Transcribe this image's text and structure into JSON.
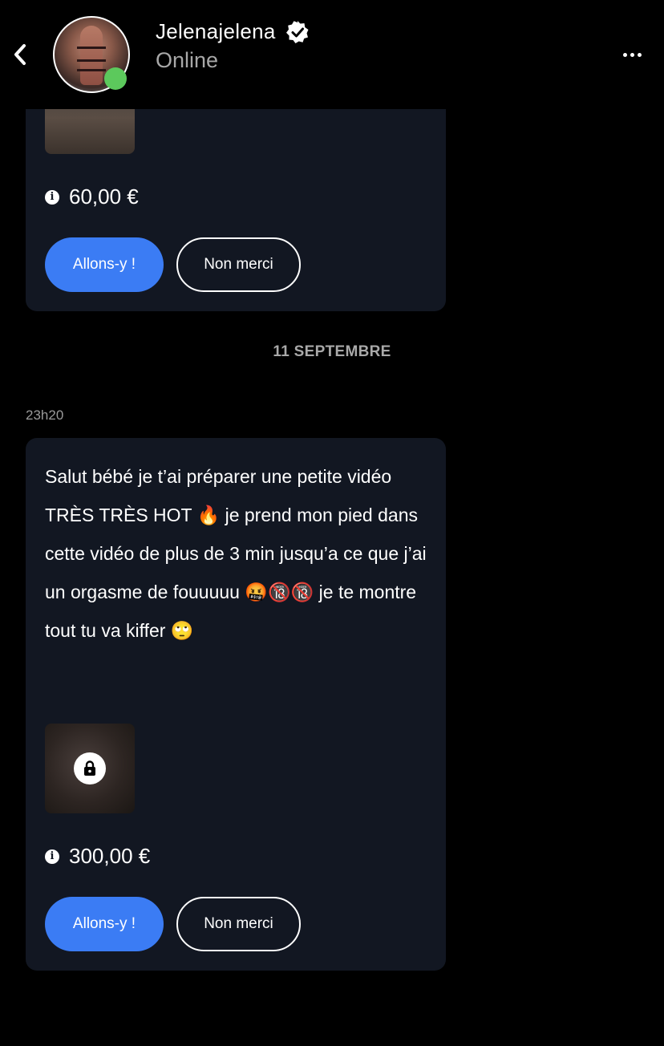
{
  "header": {
    "contact_name": "Jelenajelena",
    "status": "Online",
    "icons": {
      "back": "chevron-left-icon",
      "verified": "verified-badge-icon",
      "more": "more-horizontal-icon"
    }
  },
  "messages": [
    {
      "price": "60,00 €",
      "accept_label": "Allons-y !",
      "decline_label": "Non merci"
    },
    {
      "time": "23h20",
      "text": "Salut bébé je t’ai préparer une petite vidéo TRÈS TRÈS HOT 🔥 je prend mon pied dans cette vidéo de plus de 3 min jusqu’a ce que j’ai un orgasme de fouuuuu 🤬🔞🔞 je te montre tout tu va kiffer 🙄",
      "price": "300,00 €",
      "accept_label": "Allons-y !",
      "decline_label": "Non merci"
    }
  ],
  "date_separator": "11 SEPTEMBRE",
  "colors": {
    "background": "#000000",
    "bubble": "#121722",
    "accent": "#3b7cf4",
    "online": "#5cc95c",
    "muted": "#a8a8a8"
  }
}
